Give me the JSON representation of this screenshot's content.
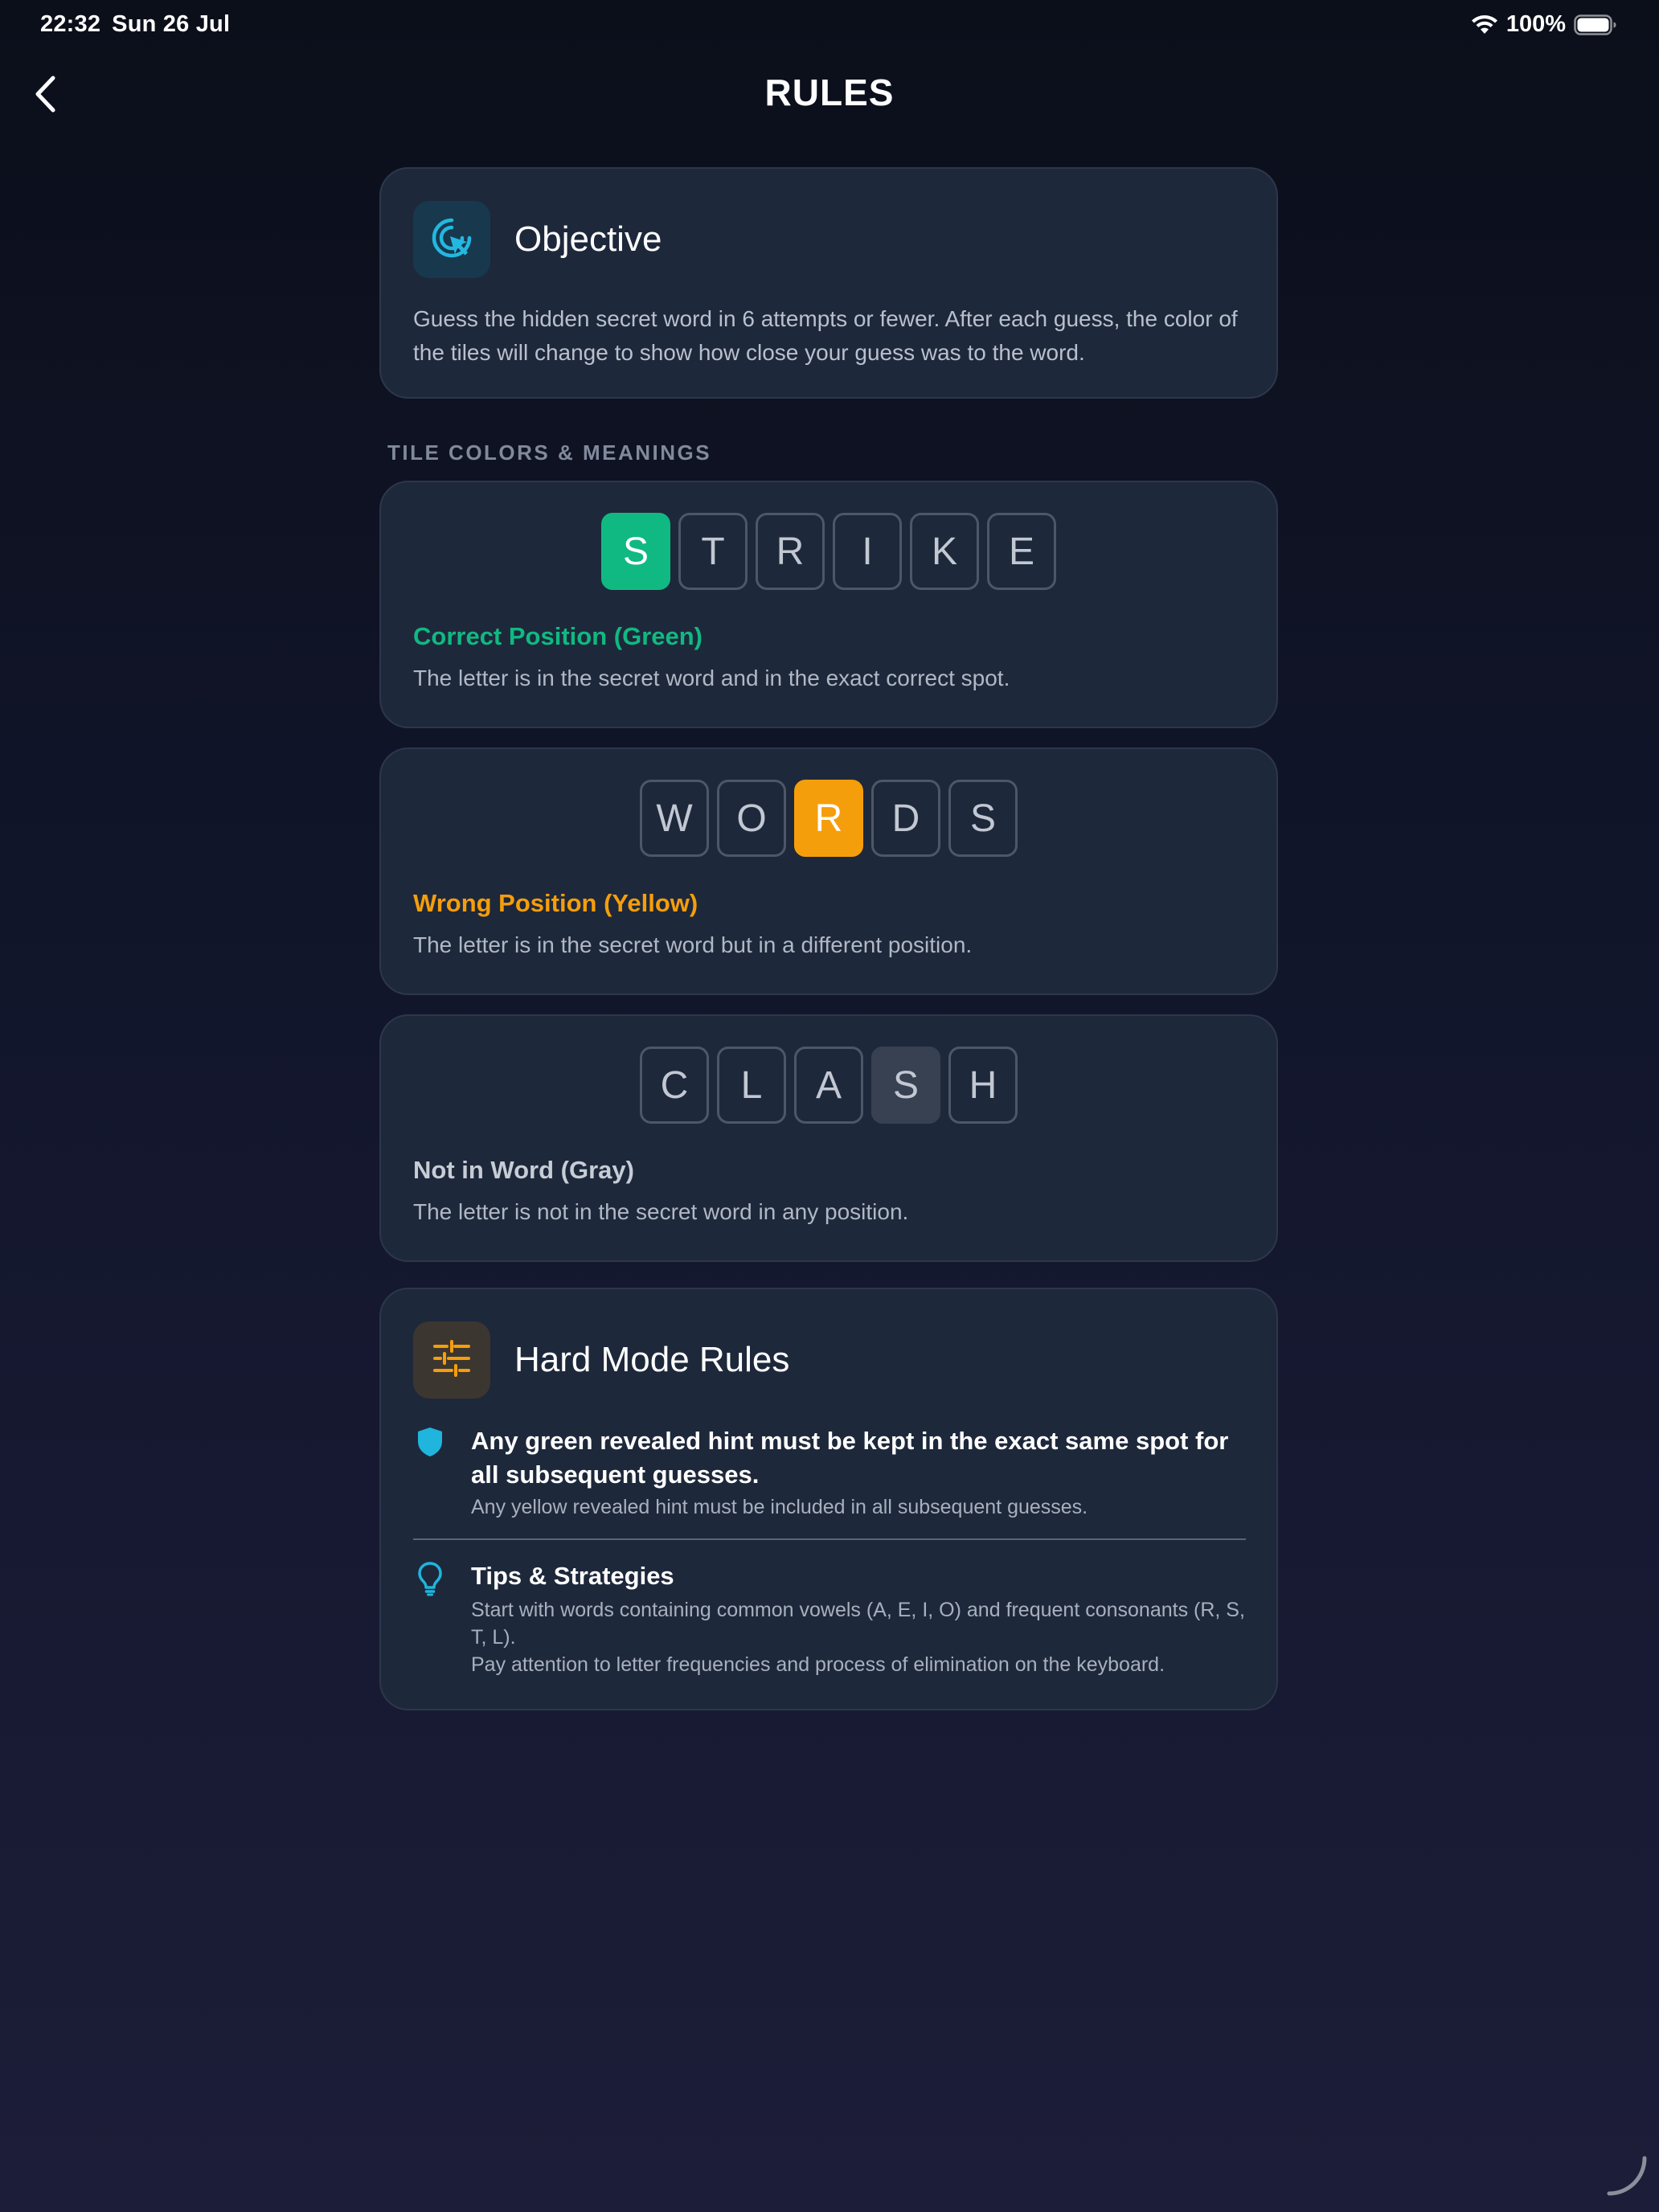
{
  "status_bar": {
    "time": "22:32",
    "date": "Sun 26 Jul",
    "battery": "100%"
  },
  "header": {
    "title": "RULES",
    "back_icon": "chevron-left-icon"
  },
  "objective": {
    "icon": "target-cursor-icon",
    "title": "Objective",
    "text": "Guess the hidden secret word in 6 attempts or fewer. After each guess, the color of the tiles will change to show how close your guess was to the word."
  },
  "tile_section": {
    "label": "TILE COLORS & MEANINGS",
    "examples": [
      {
        "letters": [
          "S",
          "T",
          "R",
          "I",
          "K",
          "E"
        ],
        "highlight_index": 0,
        "state": "green",
        "title": "Correct Position (Green)",
        "description": "The letter is in the secret word and in the exact correct spot."
      },
      {
        "letters": [
          "W",
          "O",
          "R",
          "D",
          "S"
        ],
        "highlight_index": 2,
        "state": "yellow",
        "title": "Wrong Position (Yellow)",
        "description": "The letter is in the secret word but in a different position."
      },
      {
        "letters": [
          "C",
          "L",
          "A",
          "S",
          "H"
        ],
        "highlight_index": 3,
        "state": "gray",
        "title": "Not in Word (Gray)",
        "description": "The letter is not in the secret word in any position."
      }
    ]
  },
  "hard_mode": {
    "icon": "sliders-icon",
    "title": "Hard Mode Rules",
    "rule_icon": "shield-icon",
    "rule_primary": "Any green revealed hint must be kept in the exact same spot for all subsequent guesses.",
    "rule_secondary": "Any yellow revealed hint must be included in all subsequent guesses.",
    "tips_icon": "lightbulb-icon",
    "tips_title": "Tips & Strategies",
    "tip_1": "Start with words containing common vowels (A, E, I, O) and frequent consonants (R, S, T, L).",
    "tip_2": "Pay attention to letter frequencies and process of elimination on the keyboard."
  },
  "colors": {
    "green": "#10b981",
    "yellow": "#f59e0b",
    "gray_title": "#c7cdd6",
    "accent_teal": "#22b8e0",
    "card_bg": "#1e283b"
  }
}
